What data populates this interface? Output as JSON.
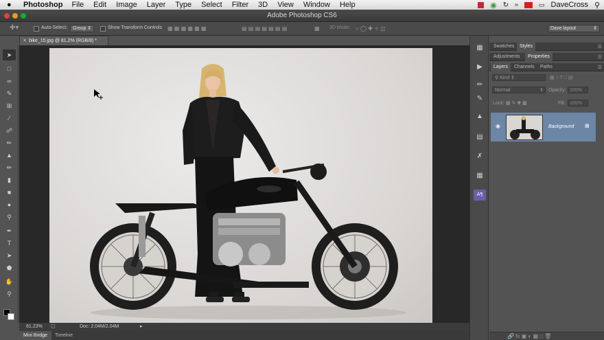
{
  "menubar": {
    "app": "Photoshop",
    "items": [
      "File",
      "Edit",
      "Image",
      "Layer",
      "Type",
      "Select",
      "Filter",
      "3D",
      "View",
      "Window",
      "Help"
    ],
    "user": "DaveCross"
  },
  "window": {
    "title": "Adobe Photoshop CS6"
  },
  "options": {
    "auto_select": "Auto-Select:",
    "group": "Group",
    "show_transform": "Show Transform Controls",
    "mode3d": "3D Mode:",
    "workspace": "Dave layout"
  },
  "document": {
    "tab": "bike_15.jpg @ 81.2% (RGB/8) *",
    "zoom": "81.23%",
    "doc": "Doc: 2.04M/2.04M"
  },
  "bottom_tabs": [
    "Mini Bridge",
    "Timeline"
  ],
  "panels": {
    "top_tabs": [
      "Swatches",
      "Styles"
    ],
    "mid_tabs": [
      "Adjustments",
      "Properties"
    ],
    "layer_tabs": [
      "Layers",
      "Channels",
      "Paths"
    ],
    "kind": "Kind",
    "blend": "Normal",
    "opacity_label": "Opacity:",
    "opacity": "100%",
    "lock_label": "Lock:",
    "fill_label": "Fill:",
    "fill": "100%",
    "layer_name": "Background"
  },
  "colors": {
    "accent": "#6d86a6",
    "panel": "#535353"
  }
}
